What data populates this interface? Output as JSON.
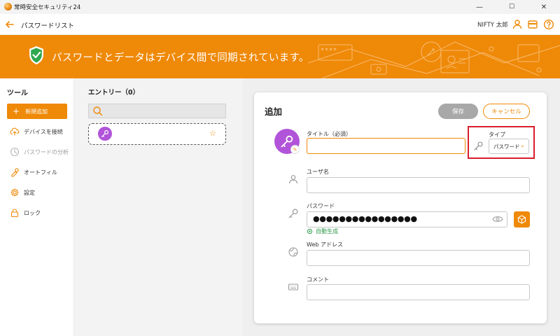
{
  "window": {
    "title": "常時安全セキュリティ24",
    "controls": [
      "—",
      "☐",
      "✕"
    ]
  },
  "nav": {
    "title": "パスワードリスト",
    "user_name": "NIFTY 太郎",
    "icons": [
      "user-icon",
      "card-icon",
      "help-icon"
    ]
  },
  "banner": {
    "text": "パスワードとデータはデバイス間で同期されています。",
    "deco_mask": "****"
  },
  "tools": {
    "heading": "ツール",
    "new_label": "新規追加",
    "items": [
      {
        "label": "デバイスを接続",
        "icon": "cloud-upload-icon",
        "disabled": false
      },
      {
        "label": "パスワードの分析",
        "icon": "analysis-icon",
        "disabled": true
      },
      {
        "label": "オートフィル",
        "icon": "autofill-icon",
        "disabled": false
      },
      {
        "label": "設定",
        "icon": "gear-icon",
        "disabled": false
      },
      {
        "label": "ロック",
        "icon": "lock-icon",
        "disabled": false
      }
    ]
  },
  "entries": {
    "heading": "エントリー（0）",
    "search_placeholder": "",
    "entry_star": "☆"
  },
  "form": {
    "title": "追加",
    "save_label": "保存",
    "cancel_label": "キャンセル",
    "title_label": "タイトル（必須）",
    "title_value": "",
    "type_label": "タイプ",
    "type_value": "パスワード",
    "username_label": "ユーザ名",
    "username_value": "",
    "password_label": "パスワード",
    "password_value": "●●●●●●●●●●●●●●●●",
    "autogen_label": "自動生成",
    "web_label": "Web アドレス",
    "web_value": "",
    "comment_label": "コメント",
    "comment_value": ""
  },
  "colors": {
    "accent": "#ef8908",
    "entry_icon": "#b154d9",
    "highlight": "#d81e2c",
    "autogen": "#2f9a4a"
  }
}
